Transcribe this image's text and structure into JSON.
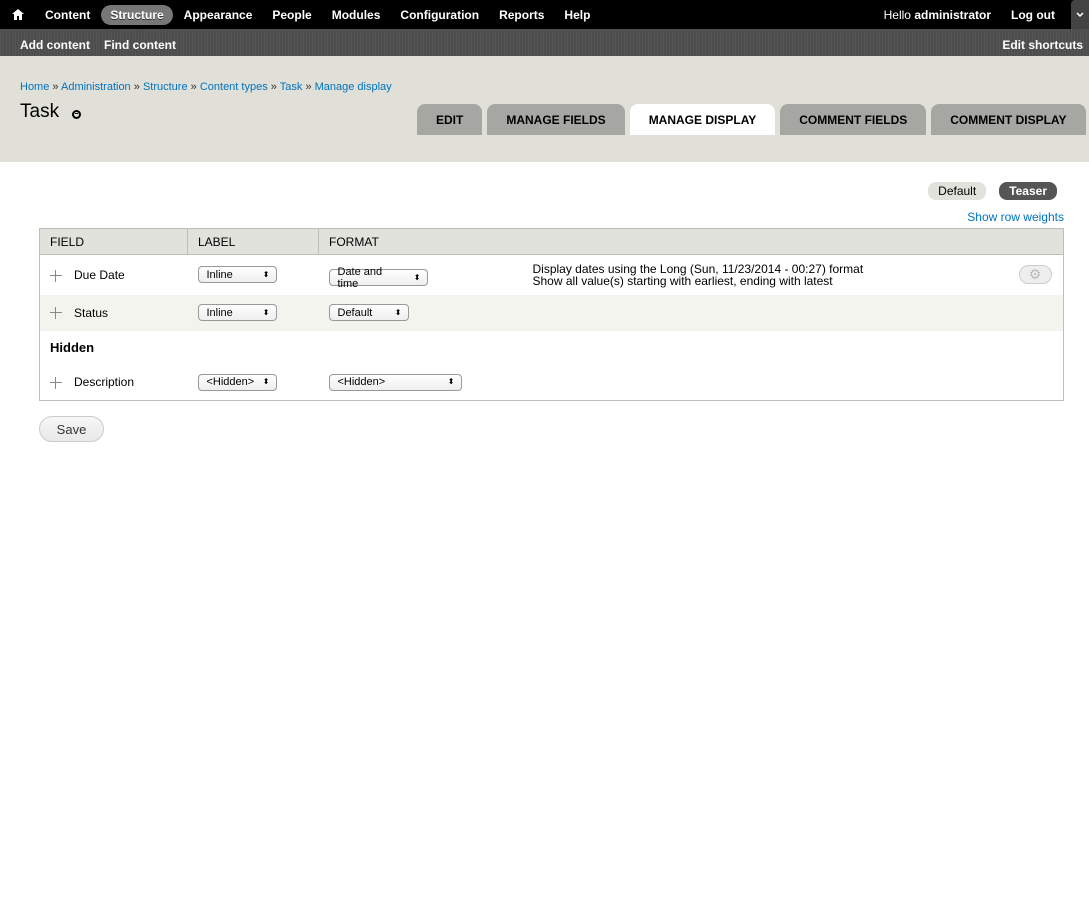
{
  "toolbar": {
    "menu": [
      "Content",
      "Structure",
      "Appearance",
      "People",
      "Modules",
      "Configuration",
      "Reports",
      "Help"
    ],
    "active": "Structure",
    "hello": "Hello",
    "user": "administrator",
    "logout": "Log out"
  },
  "shortcuts": {
    "items": [
      "Add content",
      "Find content"
    ],
    "edit": "Edit shortcuts"
  },
  "breadcrumb": [
    "Home",
    "Administration",
    "Structure",
    "Content types",
    "Task",
    "Manage display"
  ],
  "breadcrumb_sep": "»",
  "page_title": "Task",
  "tabs": [
    "Edit",
    "Manage fields",
    "Manage display",
    "Comment fields",
    "Comment display"
  ],
  "active_tab": "Manage display",
  "secondary_tabs": [
    "Default",
    "Teaser"
  ],
  "active_secondary": "Teaser",
  "row_weights": "Show row weights",
  "table": {
    "headers": [
      "Field",
      "Label",
      "Format"
    ],
    "rows": [
      {
        "field": "Due Date",
        "label": "Inline",
        "format": "Date and time",
        "summary1": "Display dates using the Long (Sun, 11/23/2014 - 00:27) format",
        "summary2": "Show all value(s) starting with earliest, ending with latest"
      },
      {
        "field": "Status",
        "label": "Inline",
        "format": "Default"
      }
    ],
    "hidden_region": "Hidden",
    "hidden_rows": [
      {
        "field": "Description",
        "label": "<Hidden>",
        "format": "<Hidden>"
      }
    ]
  },
  "save_label": "Save"
}
